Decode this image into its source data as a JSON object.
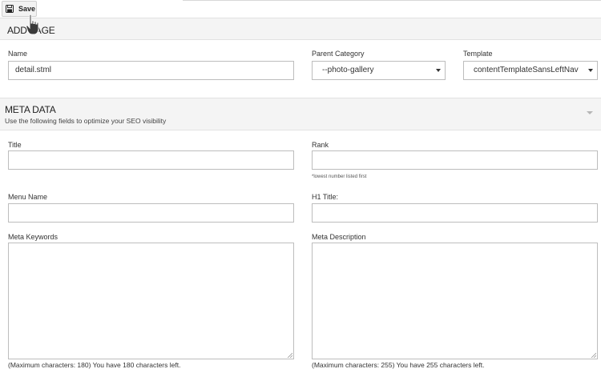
{
  "toolbar": {
    "save_label": "Save"
  },
  "add_page": {
    "title": "ADD PAGE",
    "name_label": "Name",
    "name_value": "detail.stml",
    "parent_category_label": "Parent Category",
    "parent_category_value": "--photo-gallery",
    "template_label": "Template",
    "template_value": "contentTemplateSansLeftNav"
  },
  "meta": {
    "title": "META DATA",
    "subtitle": "Use the following fields to optimize your SEO visibility",
    "title_label": "Title",
    "rank_label": "Rank",
    "rank_hint": "*lowest number listed first",
    "menu_name_label": "Menu Name",
    "h1_title_label": "H1 Title:",
    "meta_keywords_label": "Meta Keywords",
    "meta_description_label": "Meta Description",
    "keywords_counter": "(Maximum characters: 180) You have 180 characters left.",
    "description_counter": "(Maximum characters: 255) You have 255 characters left."
  },
  "colors": {
    "border": "#bdbdbd",
    "section_bg": "#f4f4f4",
    "text": "#333333"
  },
  "icons": {
    "save": "floppy-disk-icon",
    "cursor": "hand-pointer-icon",
    "collapse": "caret-down-icon"
  }
}
